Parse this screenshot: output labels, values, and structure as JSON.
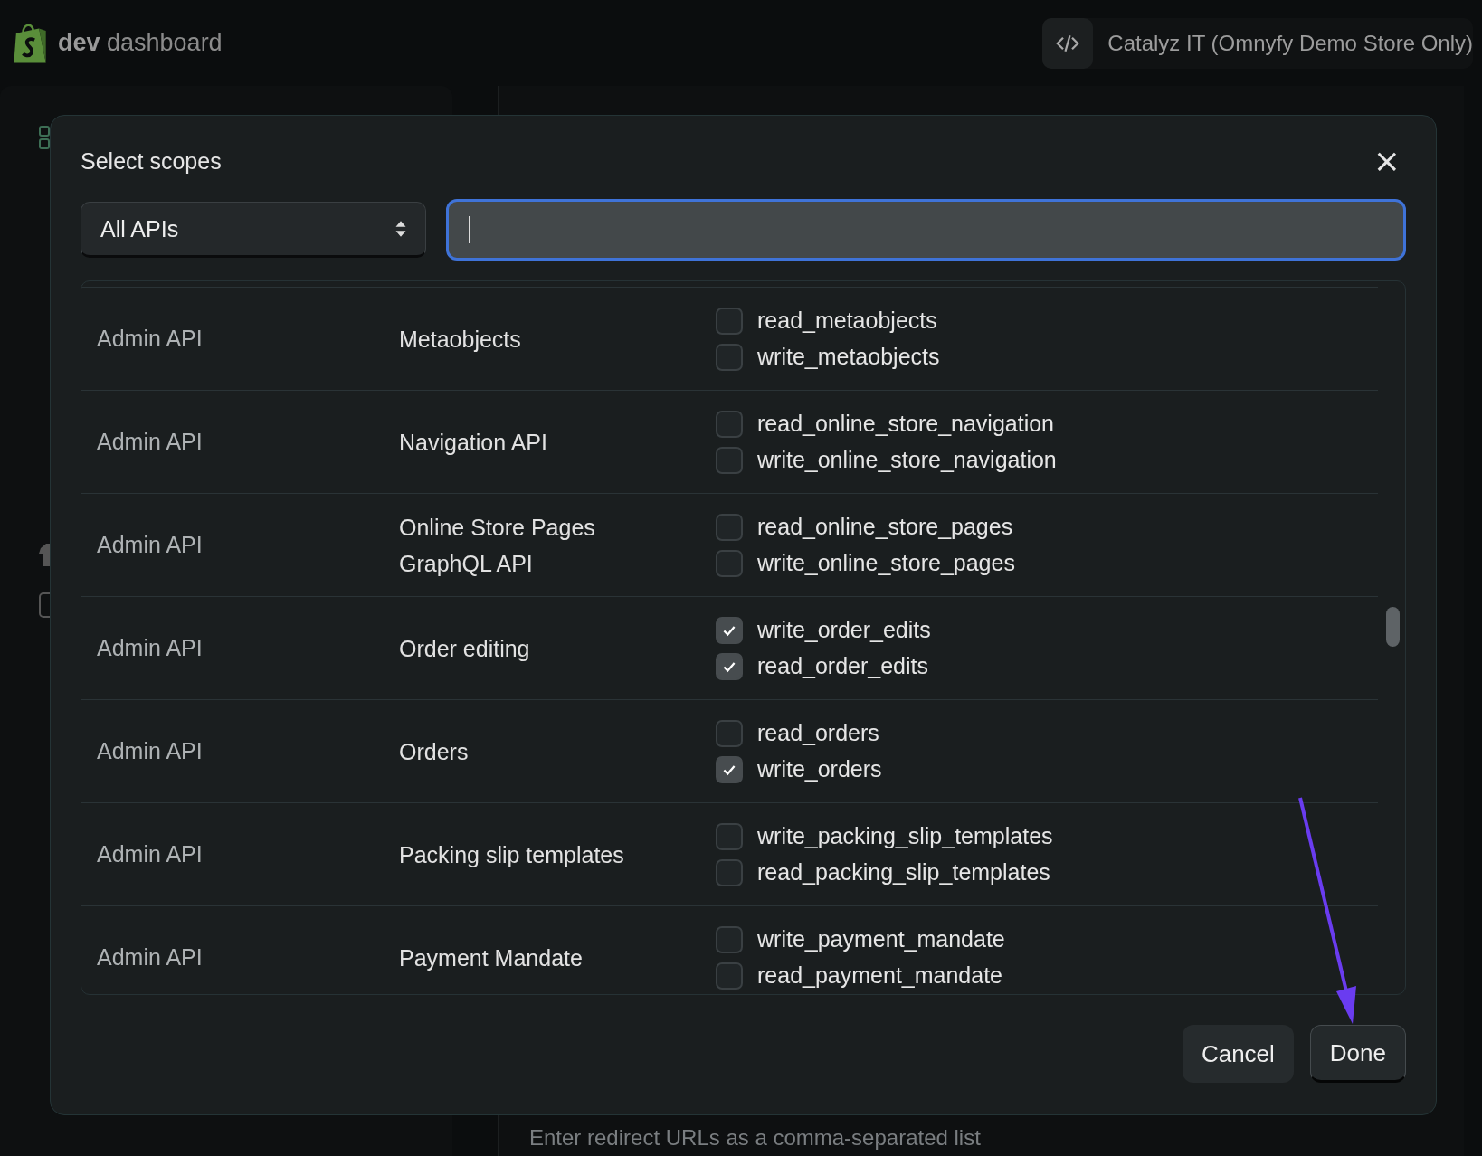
{
  "top_bar": {
    "brand_bold": "dev",
    "brand_rest": "dashboard",
    "store": "Catalyz IT (Omnyfy Demo Store Only)"
  },
  "background": {
    "hint": "Enter redirect URLs as a comma-separated list"
  },
  "dialog": {
    "title": "Select scopes",
    "close": "×",
    "filter": {
      "value": "All APIs"
    },
    "rows": [
      {
        "api": "Admin API",
        "name": "Metaobjects",
        "scopes": [
          {
            "label": "read_metaobjects",
            "checked": false
          },
          {
            "label": "write_metaobjects",
            "checked": false
          }
        ]
      },
      {
        "api": "Admin API",
        "name": "Navigation API",
        "scopes": [
          {
            "label": "read_online_store_navigation",
            "checked": false
          },
          {
            "label": "write_online_store_navigation",
            "checked": false
          }
        ]
      },
      {
        "api": "Admin API",
        "name": "Online Store Pages GraphQL API",
        "scopes": [
          {
            "label": "read_online_store_pages",
            "checked": false
          },
          {
            "label": "write_online_store_pages",
            "checked": false
          }
        ]
      },
      {
        "api": "Admin API",
        "name": "Order editing",
        "scopes": [
          {
            "label": "write_order_edits",
            "checked": true
          },
          {
            "label": "read_order_edits",
            "checked": true
          }
        ]
      },
      {
        "api": "Admin API",
        "name": "Orders",
        "scopes": [
          {
            "label": "read_orders",
            "checked": false
          },
          {
            "label": "write_orders",
            "checked": true
          }
        ]
      },
      {
        "api": "Admin API",
        "name": "Packing slip templates",
        "scopes": [
          {
            "label": "write_packing_slip_templates",
            "checked": false
          },
          {
            "label": "read_packing_slip_templates",
            "checked": false
          }
        ]
      },
      {
        "api": "Admin API",
        "name": "Payment Mandate",
        "scopes": [
          {
            "label": "write_payment_mandate",
            "checked": false
          },
          {
            "label": "read_payment_mandate",
            "checked": false
          }
        ]
      }
    ],
    "buttons": [
      {
        "label": "Cancel",
        "kind": "secondary"
      },
      {
        "label": "Done",
        "kind": "primary"
      }
    ]
  }
}
